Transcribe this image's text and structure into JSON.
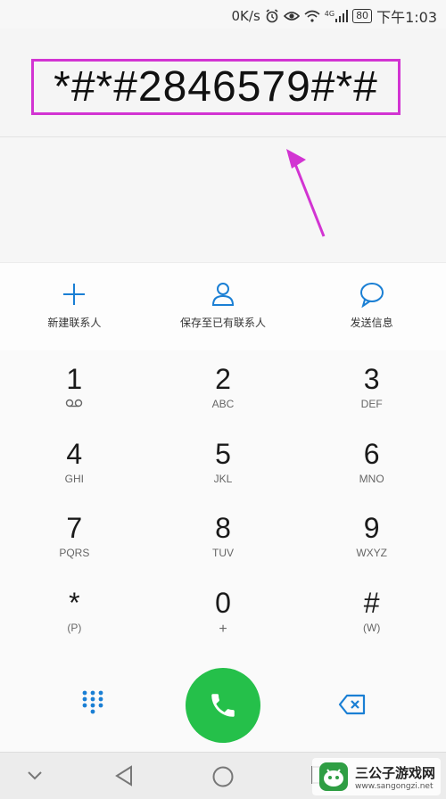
{
  "status_bar": {
    "net_speed": "0K/s",
    "signal_label": "4G",
    "battery": "80",
    "time": "下午1:03"
  },
  "display": {
    "number": "*#*#2846579#*#"
  },
  "actions": [
    {
      "label": "新建联系人",
      "icon": "plus-icon"
    },
    {
      "label": "保存至已有联系人",
      "icon": "person-icon"
    },
    {
      "label": "发送信息",
      "icon": "message-bubble-icon"
    }
  ],
  "keypad": [
    {
      "digit": "1",
      "letters": "",
      "sub_icon": "voicemail-icon"
    },
    {
      "digit": "2",
      "letters": "ABC"
    },
    {
      "digit": "3",
      "letters": "DEF"
    },
    {
      "digit": "4",
      "letters": "GHI"
    },
    {
      "digit": "5",
      "letters": "JKL"
    },
    {
      "digit": "6",
      "letters": "MNO"
    },
    {
      "digit": "7",
      "letters": "PQRS"
    },
    {
      "digit": "8",
      "letters": "TUV"
    },
    {
      "digit": "9",
      "letters": "WXYZ"
    },
    {
      "digit": "*",
      "letters": "(P)"
    },
    {
      "digit": "0",
      "letters": "+"
    },
    {
      "digit": "#",
      "letters": "(W)"
    }
  ],
  "colors": {
    "accent": "#1a7fd4",
    "call": "#25c04a",
    "highlight": "#d234d2"
  },
  "watermark": {
    "title": "三公子游戏网",
    "url": "www.sangongzi.net"
  }
}
